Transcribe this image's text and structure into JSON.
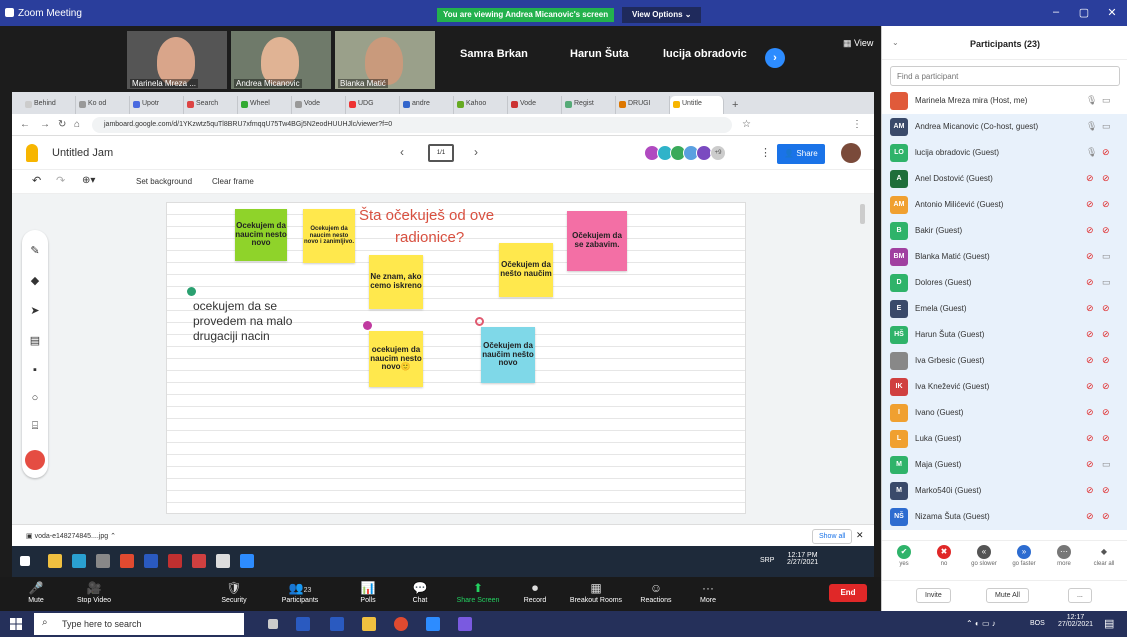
{
  "zoom": {
    "title": "Zoom Meeting",
    "share_banner": "You are viewing Andrea Micanovic's screen",
    "view_options": "View Options ⌄",
    "view": "View"
  },
  "video_tiles": [
    {
      "name": "Marinela Mreza ..."
    },
    {
      "name": "Andrea Micanovic"
    },
    {
      "name": "Blanka Matić"
    }
  ],
  "name_tiles": [
    "Samra Brkan",
    "Harun Šuta",
    "lucija obradovic"
  ],
  "browser": {
    "tabs": [
      "Behind",
      "Ko od",
      "Upotr",
      "Search",
      "Wheel",
      "Vode",
      "UDG",
      "andre",
      "Kahoo",
      "Vode",
      "Regist",
      "DRUGI",
      "Untitle"
    ],
    "active_tab": "Untitle",
    "url": "jamboard.google.com/d/1YKzwtz5quTl8BRU7xfmqqU75Tw4BGj5N2eodHUUHJlc/viewer?f=0"
  },
  "jam": {
    "title": "Untitled Jam",
    "frame_label": "1/1",
    "collab_more": "+9",
    "share_label": "Share",
    "set_background": "Set background",
    "clear_frame": "Clear frame"
  },
  "board": {
    "heading_line1": "Šta očekuješ od ove",
    "heading_line2": "radionice?",
    "text_note": [
      "ocekujem da se",
      "provedem na malo",
      "drugaciji nacin"
    ],
    "stickies": [
      {
        "text": "Ocekujem da naucim nesto novo",
        "color": "#8fd32a"
      },
      {
        "text": "Ocekujem da naucim nesto novo i zanimljivo.",
        "color": "#ffe84d"
      },
      {
        "text": "Ne znam, ako cemo iskreno",
        "color": "#ffe84d"
      },
      {
        "text": "Očekujem da nešto naučim",
        "color": "#ffe84d"
      },
      {
        "text": "Očekujem da se zabavim.",
        "color": "#f36fa5"
      },
      {
        "text": "ocekujem da naucim nesto novo🙂",
        "color": "#ffe84d"
      },
      {
        "text": "Očekujem da naučim nešto novo",
        "color": "#7fd8e8"
      }
    ]
  },
  "downloads": {
    "file": "voda-e148274845....jpg",
    "show_all": "Show all"
  },
  "inner_taskbar": {
    "lang": "SRP",
    "time": "12:17 PM",
    "date": "2/27/2021"
  },
  "controls": [
    {
      "icon": "🎤",
      "label": "Mute"
    },
    {
      "icon": "🎥",
      "label": "Stop Video"
    },
    {
      "icon": "🛡",
      "label": "Security"
    },
    {
      "icon": "👥",
      "label": "Participants",
      "count": "23"
    },
    {
      "icon": "📊",
      "label": "Polls"
    },
    {
      "icon": "💬",
      "label": "Chat"
    },
    {
      "icon": "⬆",
      "label": "Share Screen"
    },
    {
      "icon": "⏺",
      "label": "Record"
    },
    {
      "icon": "▦",
      "label": "Breakout Rooms"
    },
    {
      "icon": "☺",
      "label": "Reactions"
    },
    {
      "icon": "···",
      "label": "More"
    }
  ],
  "end_label": "End",
  "participants": {
    "title": "Participants (23)",
    "search_placeholder": "Find a participant",
    "list": [
      {
        "initials": "",
        "name": "Marinela Mreza mira (Host, me)",
        "color": "#e05a3a",
        "muted": false
      },
      {
        "initials": "AM",
        "name": "Andrea Micanovic (Co-host, guest)",
        "color": "#3a4a6a",
        "muted": false
      },
      {
        "initials": "LO",
        "name": "lucija obradovic (Guest)",
        "color": "#2fb36a",
        "muted": false
      },
      {
        "initials": "A",
        "name": "Anel Dostović (Guest)",
        "color": "#1e6e3a",
        "muted": true
      },
      {
        "initials": "AM",
        "name": "Antonio Milićević (Guest)",
        "color": "#f0a030",
        "muted": true
      },
      {
        "initials": "B",
        "name": "Bakir (Guest)",
        "color": "#2fb36a",
        "muted": true
      },
      {
        "initials": "BM",
        "name": "Blanka Matić (Guest)",
        "color": "#a040a0",
        "muted": true
      },
      {
        "initials": "D",
        "name": "Dolores (Guest)",
        "color": "#2fb36a",
        "muted": true
      },
      {
        "initials": "E",
        "name": "Emela (Guest)",
        "color": "#3a4a6a",
        "muted": true
      },
      {
        "initials": "HŠ",
        "name": "Harun Šuta (Guest)",
        "color": "#2fb36a",
        "muted": true
      },
      {
        "initials": "",
        "name": "Iva Grbesic (Guest)",
        "color": "#888888",
        "muted": true
      },
      {
        "initials": "IK",
        "name": "Iva Knežević (Guest)",
        "color": "#d04040",
        "muted": true
      },
      {
        "initials": "I",
        "name": "Ivano (Guest)",
        "color": "#f0a030",
        "muted": true
      },
      {
        "initials": "L",
        "name": "Luka (Guest)",
        "color": "#f0a030",
        "muted": true
      },
      {
        "initials": "M",
        "name": "Maja (Guest)",
        "color": "#2fb36a",
        "muted": true
      },
      {
        "initials": "M",
        "name": "Marko540i (Guest)",
        "color": "#3a4a6a",
        "muted": true
      },
      {
        "initials": "NŠ",
        "name": "Nizama Šuta (Guest)",
        "color": "#2d6cd0",
        "muted": true
      }
    ],
    "reactions": [
      {
        "label": "yes",
        "color": "#2fb36a",
        "glyph": "✔"
      },
      {
        "label": "no",
        "color": "#e02828",
        "glyph": "✖"
      },
      {
        "label": "go slower",
        "color": "#555555",
        "glyph": "«"
      },
      {
        "label": "go faster",
        "color": "#2d6cd0",
        "glyph": "»"
      },
      {
        "label": "more",
        "color": "#777777",
        "glyph": "⋯"
      },
      {
        "label": "clear all",
        "color": "#ffffff",
        "glyph": "◆"
      }
    ],
    "invite": "Invite",
    "mute_all": "Mute All",
    "more": "..."
  },
  "windows": {
    "search_placeholder": "Type here to search",
    "lang": "BOS",
    "time": "12:17",
    "date": "27/02/2021"
  }
}
